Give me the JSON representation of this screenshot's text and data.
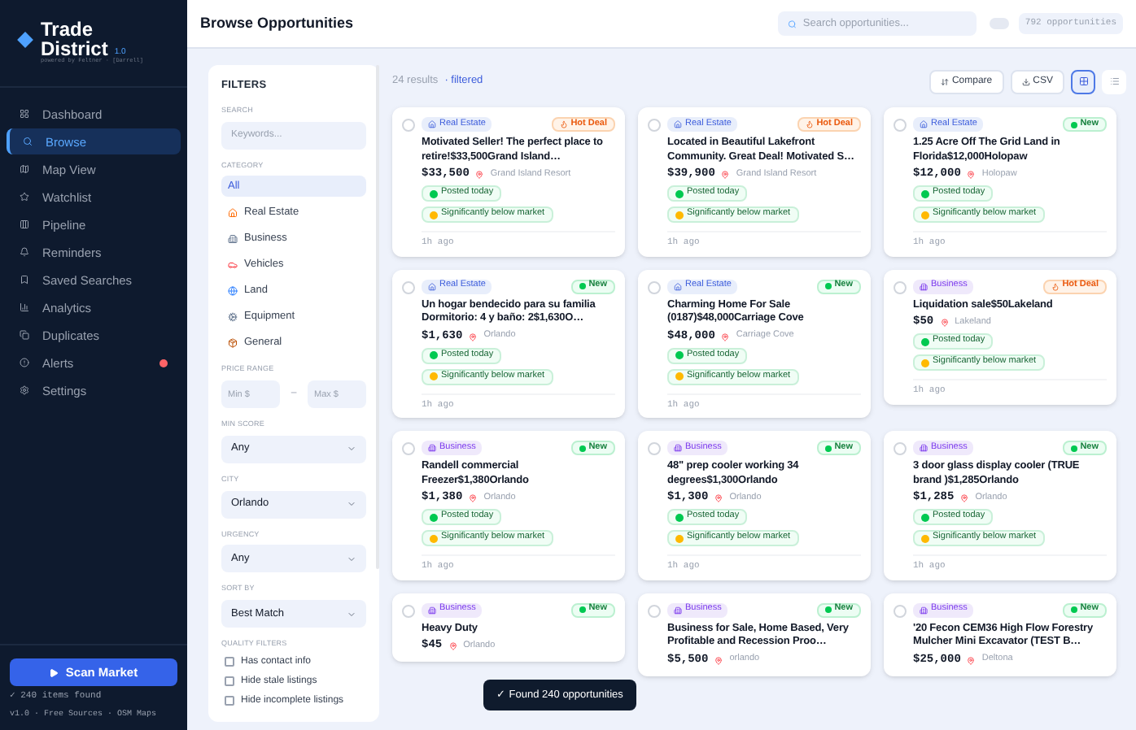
{
  "brand": {
    "name_line1": "Trade",
    "name_line2": "District",
    "version": "1.0",
    "subtitle": "powered by Feltner · [Darrell]"
  },
  "nav": [
    {
      "label": "Dashboard",
      "selected": false,
      "alert": false
    },
    {
      "label": "Browse",
      "selected": true,
      "alert": false
    },
    {
      "label": "Map View",
      "selected": false,
      "alert": false
    },
    {
      "label": "Watchlist",
      "selected": false,
      "alert": false
    },
    {
      "label": "Pipeline",
      "selected": false,
      "alert": false
    },
    {
      "label": "Reminders",
      "selected": false,
      "alert": false
    },
    {
      "label": "Saved Searches",
      "selected": false,
      "alert": false
    },
    {
      "label": "Analytics",
      "selected": false,
      "alert": false
    },
    {
      "label": "Duplicates",
      "selected": false,
      "alert": false
    },
    {
      "label": "Alerts",
      "selected": false,
      "alert": true
    },
    {
      "label": "Settings",
      "selected": false,
      "alert": false
    }
  ],
  "scan_button": "Scan Market",
  "scan_status": "✓ 240 items found",
  "footer": "v1.0 · Free Sources · OSM Maps",
  "header": {
    "title": "Browse Opportunities",
    "search_placeholder": "Search opportunities...",
    "toggle_on": false,
    "count": "792 opportunities"
  },
  "filters": {
    "title": "FILTERS",
    "search_label": "SEARCH",
    "search_placeholder": "Keywords...",
    "category_label": "CATEGORY",
    "categories": [
      {
        "label": "All",
        "selected": true
      },
      {
        "label": "Real Estate",
        "selected": false
      },
      {
        "label": "Business",
        "selected": false
      },
      {
        "label": "Vehicles",
        "selected": false
      },
      {
        "label": "Land",
        "selected": false
      },
      {
        "label": "Equipment",
        "selected": false
      },
      {
        "label": "General",
        "selected": false
      }
    ],
    "price_label": "PRICE RANGE",
    "min_placeholder": "Min $",
    "range_dash": "–",
    "max_placeholder": "Max $",
    "selects": [
      {
        "label": "MIN SCORE",
        "value": "Any"
      },
      {
        "label": "CITY",
        "value": "Orlando"
      },
      {
        "label": "URGENCY",
        "value": "Any"
      },
      {
        "label": "SORT BY",
        "value": "Best Match"
      }
    ],
    "quality_label": "QUALITY FILTERS",
    "quality": [
      {
        "label": "Has contact info",
        "checked": false
      },
      {
        "label": "Hide stale listings",
        "checked": false
      },
      {
        "label": "Hide incomplete listings",
        "checked": false
      }
    ]
  },
  "toolbar": {
    "results": "24 results",
    "filtered": "· filtered",
    "compare": "Compare",
    "csv": "CSV",
    "views": [
      {
        "kind": "grid",
        "selected": true
      },
      {
        "kind": "list",
        "selected": false
      }
    ]
  },
  "cards": [
    {
      "checked": false,
      "category": {
        "kind": "real_estate",
        "label": "Real Estate"
      },
      "tag": {
        "kind": "hot",
        "label": "Hot Deal"
      },
      "title": "Motivated Seller! The perfect place to retire!$33,500Grand Island…",
      "price": "$33,500",
      "location": "Grand Island Resort",
      "badges": [
        {
          "kind": "posted",
          "label": "Posted today"
        },
        {
          "kind": "below",
          "label": "Significantly below market"
        }
      ],
      "time": "1h ago"
    },
    {
      "checked": false,
      "category": {
        "kind": "real_estate",
        "label": "Real Estate"
      },
      "tag": {
        "kind": "hot",
        "label": "Hot Deal"
      },
      "title": "Located in Beautiful Lakefront Community. Great Deal! Motivated S…",
      "price": "$39,900",
      "location": "Grand Island Resort",
      "badges": [
        {
          "kind": "posted",
          "label": "Posted today"
        },
        {
          "kind": "below",
          "label": "Significantly below market"
        }
      ],
      "time": "1h ago"
    },
    {
      "checked": false,
      "category": {
        "kind": "real_estate",
        "label": "Real Estate"
      },
      "tag": {
        "kind": "new",
        "label": "New"
      },
      "title": "1.25 Acre Off The Grid Land in Florida$12,000Holopaw",
      "price": "$12,000",
      "location": "Holopaw",
      "badges": [
        {
          "kind": "posted",
          "label": "Posted today"
        },
        {
          "kind": "below",
          "label": "Significantly below market"
        }
      ],
      "time": "1h ago"
    },
    {
      "checked": false,
      "category": {
        "kind": "real_estate",
        "label": "Real Estate"
      },
      "tag": {
        "kind": "new",
        "label": "New"
      },
      "title": "Un hogar bendecido para su familia Dormitorio: 4 y baño: 2$1,630O…",
      "price": "$1,630",
      "location": "Orlando",
      "badges": [
        {
          "kind": "posted",
          "label": "Posted today"
        },
        {
          "kind": "below",
          "label": "Significantly below market"
        }
      ],
      "time": "1h ago"
    },
    {
      "checked": false,
      "category": {
        "kind": "real_estate",
        "label": "Real Estate"
      },
      "tag": {
        "kind": "new",
        "label": "New"
      },
      "title": "Charming Home For Sale (0187)$48,000Carriage Cove",
      "price": "$48,000",
      "location": "Carriage Cove",
      "badges": [
        {
          "kind": "posted",
          "label": "Posted today"
        },
        {
          "kind": "below",
          "label": "Significantly below market"
        }
      ],
      "time": "1h ago"
    },
    {
      "checked": false,
      "category": {
        "kind": "business",
        "label": "Business"
      },
      "tag": {
        "kind": "hot",
        "label": "Hot Deal"
      },
      "title": "Liquidation sale$50Lakeland",
      "price": "$50",
      "location": "Lakeland",
      "badges": [
        {
          "kind": "posted",
          "label": "Posted today"
        },
        {
          "kind": "below",
          "label": "Significantly below market"
        }
      ],
      "time": "1h ago"
    },
    {
      "checked": false,
      "category": {
        "kind": "business",
        "label": "Business"
      },
      "tag": {
        "kind": "new",
        "label": "New"
      },
      "title": "Randell commercial Freezer$1,380Orlando",
      "price": "$1,380",
      "location": "Orlando",
      "badges": [
        {
          "kind": "posted",
          "label": "Posted today"
        },
        {
          "kind": "below",
          "label": "Significantly below market"
        }
      ],
      "time": "1h ago"
    },
    {
      "checked": false,
      "category": {
        "kind": "business",
        "label": "Business"
      },
      "tag": {
        "kind": "new",
        "label": "New"
      },
      "title": "48\" prep cooler working 34 degrees$1,300Orlando",
      "price": "$1,300",
      "location": "Orlando",
      "badges": [
        {
          "kind": "posted",
          "label": "Posted today"
        },
        {
          "kind": "below",
          "label": "Significantly below market"
        }
      ],
      "time": "1h ago"
    },
    {
      "checked": false,
      "category": {
        "kind": "business",
        "label": "Business"
      },
      "tag": {
        "kind": "new",
        "label": "New"
      },
      "title": "3 door glass display cooler (TRUE brand )$1,285Orlando",
      "price": "$1,285",
      "location": "Orlando",
      "badges": [
        {
          "kind": "posted",
          "label": "Posted today"
        },
        {
          "kind": "below",
          "label": "Significantly below market"
        }
      ],
      "time": "1h ago"
    },
    {
      "checked": false,
      "category": {
        "kind": "business",
        "label": "Business"
      },
      "tag": {
        "kind": "new",
        "label": "New"
      },
      "title": "Heavy Duty",
      "price": "$45",
      "location": "Orlando"
    },
    {
      "checked": false,
      "category": {
        "kind": "business",
        "label": "Business"
      },
      "tag": {
        "kind": "new",
        "label": "New"
      },
      "title": "Business for Sale, Home Based, Very Profitable and Recession Proo…",
      "price": "$5,500",
      "location": "orlando"
    },
    {
      "checked": false,
      "category": {
        "kind": "business",
        "label": "Business"
      },
      "tag": {
        "kind": "new",
        "label": "New"
      },
      "title": "'20 Fecon CEM36 High Flow Forestry Mulcher Mini Excavator (TEST B…",
      "price": "$25,000",
      "location": "Deltona"
    }
  ],
  "toast": "✓ Found 240 opportunities"
}
